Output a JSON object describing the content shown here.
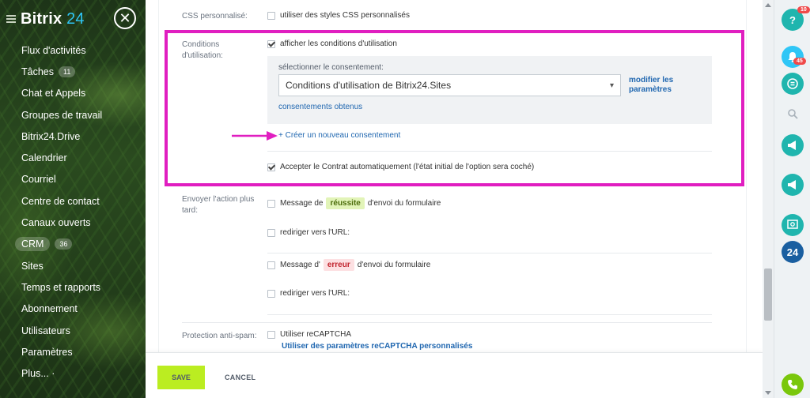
{
  "sidebar": {
    "brand_name": "Bitrix",
    "brand_number": "24",
    "close_icon": "close-icon",
    "items": [
      {
        "label": "Flux d'activités",
        "badge": null
      },
      {
        "label": "Tâches",
        "badge": "11"
      },
      {
        "label": "Chat et Appels",
        "badge": null
      },
      {
        "label": "Groupes de travail",
        "badge": null
      },
      {
        "label": "Bitrix24.Drive",
        "badge": null
      },
      {
        "label": "Calendrier",
        "badge": null
      },
      {
        "label": "Courriel",
        "badge": null
      },
      {
        "label": "Centre de contact",
        "badge": null
      },
      {
        "label": "Canaux ouverts",
        "badge": null
      },
      {
        "label": "CRM",
        "badge": "36"
      },
      {
        "label": "Sites",
        "badge": null
      },
      {
        "label": "Temps et rapports",
        "badge": null
      },
      {
        "label": "Abonnement",
        "badge": null
      },
      {
        "label": "Utilisateurs",
        "badge": null
      },
      {
        "label": "Paramètres",
        "badge": null
      },
      {
        "label": "Plus... ·",
        "badge": null
      }
    ]
  },
  "form": {
    "css_label": "CSS personnalisé:",
    "css_option": "utiliser des styles CSS personnalisés",
    "terms_label": "Conditions d'utilisation:",
    "terms_show": "afficher les conditions d'utilisation",
    "select_consent_label": "sélectionner le consentement:",
    "select_value": "Conditions d'utilisation de Bitrix24.Sites",
    "modify_params": "modifier les paramètres",
    "consents_obtained": "consentements obtenus",
    "create_consent": "+ Créer un nouveau consentement",
    "accept_auto": "Accepter le Contrat automatiquement (l'état initial de l'option sera coché)",
    "send_action_label": "Envoyer l'action plus tard:",
    "msg_success_pre": "Message de",
    "msg_success_tag": "réussite",
    "msg_success_post": "d'envoi du formulaire",
    "redirect_url_1": "rediriger vers l'URL:",
    "msg_error_pre": "Message d'",
    "msg_error_tag": "erreur",
    "msg_error_post": "d'envoi du formulaire",
    "redirect_url_2": "rediriger vers l'URL:",
    "antispam_label": "Protection anti-spam:",
    "recaptcha": "Utiliser reCAPTCHA",
    "recaptcha_params": "Utiliser des paramètres reCAPTCHA personnalisés"
  },
  "footer": {
    "save": "SAVE",
    "cancel": "CANCEL"
  },
  "right_panel": {
    "help_badge": "10",
    "notif_badge": "45",
    "b24_label": "24"
  },
  "colors": {
    "accent_green": "#bbed21",
    "highlight_magenta": "#e01ec0",
    "link_blue": "#2067b0",
    "teal": "#1fb5ae"
  }
}
